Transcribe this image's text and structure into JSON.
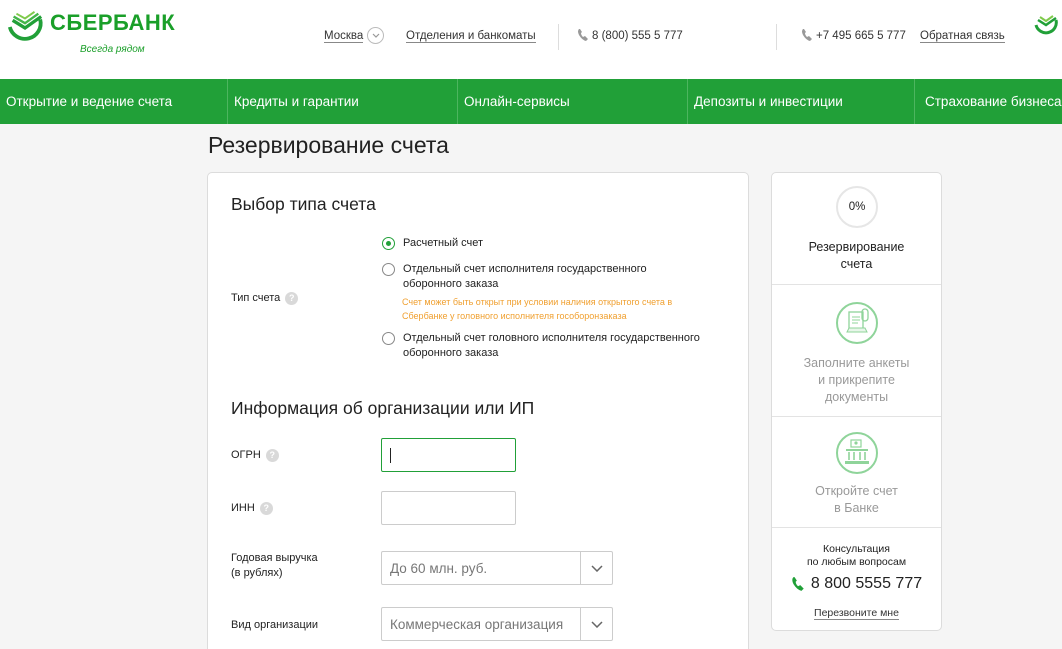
{
  "header": {
    "logo_name": "СБЕРБАНК",
    "logo_slogan": "Всегда рядом",
    "city": "Москва",
    "branches_link": "Отделения и банкоматы",
    "phone_1": "8 (800) 555 5 777",
    "phone_2": "+7 495 665 5 777",
    "feedback_link": "Обратная связь"
  },
  "nav": {
    "items": [
      "Открытие и ведение счета",
      "Кредиты и гарантии",
      "Онлайн-сервисы",
      "Депозиты и инвестиции",
      "Страхование бизнеса"
    ]
  },
  "page_title": "Резервирование счета",
  "account_type": {
    "section_title": "Выбор типа счета",
    "field_label": "Тип счета",
    "options": [
      "Расчетный счет",
      "Отдельный счет исполнителя государственного оборонного заказа",
      "Отдельный счет головного исполнителя государственного оборонного заказа"
    ],
    "selected_index": 0,
    "note": "Счет может быть открыт при условии наличия открытого счета в Сбербанке у головного исполнителя гособоронзаказа"
  },
  "org_info": {
    "section_title": "Информация об организации или ИП",
    "ogrn_label": "ОГРН",
    "ogrn_value": "",
    "inn_label": "ИНН",
    "inn_value": "",
    "revenue_label_1": "Годовая выручка",
    "revenue_label_2": "(в рублях)",
    "revenue_value": "До 60 млн. руб.",
    "org_type_label": "Вид организации",
    "org_type_value": "Коммерческая организация"
  },
  "sidebar": {
    "progress": "0%",
    "step_1_line_1": "Резервирование",
    "step_1_line_2": "счета",
    "step_2_line_1": "Заполните анкеты",
    "step_2_line_2": "и прикрепите",
    "step_2_line_3": "документы",
    "step_3_line_1": "Откройте счет",
    "step_3_line_2": "в Банке",
    "consult_line_1": "Консультация",
    "consult_line_2": "по любым вопросам",
    "phone": "8 800 5555 777",
    "callback_link": "Перезвоните мне"
  },
  "colors": {
    "brand_green": "#21a038",
    "note_orange": "#f0a030"
  },
  "icons": [
    "sberbank-logo-icon",
    "chevron-down-icon",
    "phone-icon",
    "help-icon",
    "document-icon",
    "bank-building-icon"
  ]
}
